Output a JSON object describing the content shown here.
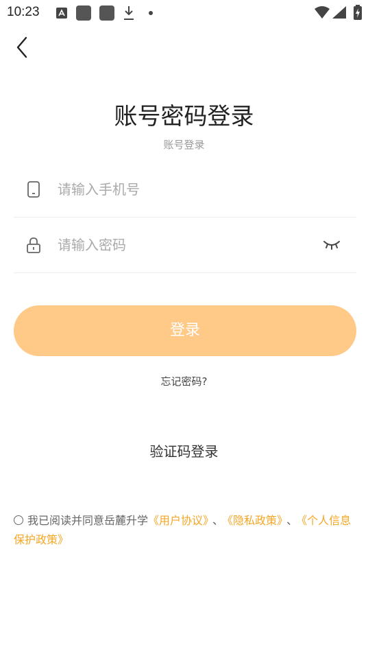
{
  "status_bar": {
    "time": "10:23",
    "icons": [
      "a-badge-icon",
      "app-square-icon",
      "app-square-icon",
      "download-icon",
      "dot-icon",
      "wifi-icon",
      "signal-icon",
      "battery-charging-icon"
    ]
  },
  "header": {
    "back_icon": "chevron-left-icon"
  },
  "page": {
    "title": "账号密码登录",
    "subtitle": "账号登录"
  },
  "form": {
    "phone": {
      "icon": "phone-icon",
      "placeholder": "请输入手机号",
      "value": ""
    },
    "password": {
      "icon": "lock-icon",
      "placeholder": "请输入密码",
      "value": "",
      "toggle_icon": "eye-closed-icon"
    },
    "login_label": "登录",
    "forgot_label": "忘记密码?",
    "code_login_label": "验证码登录"
  },
  "agreement": {
    "prefix": "我已阅读并同意岳麓升学",
    "user_agreement": "《用户协议》",
    "sep1": "、",
    "privacy_policy": "《隐私政策》",
    "sep2": "、",
    "personal_info_policy": "《个人信息保护政策》"
  },
  "colors": {
    "accent": "#f5a623",
    "button_bg": "#ffc987",
    "button_text": "#ffffff",
    "placeholder": "#aaaaaa",
    "divider": "#eeeeee"
  }
}
